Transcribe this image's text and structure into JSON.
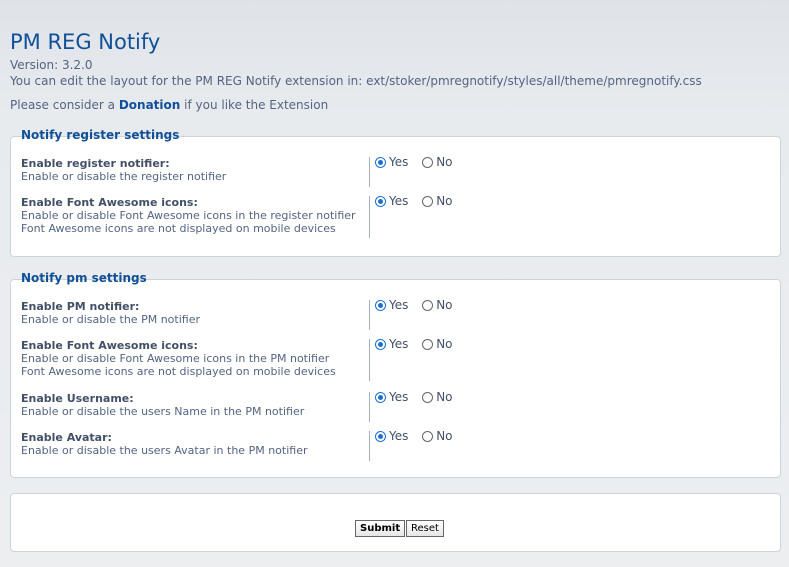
{
  "header": {
    "title": "PM REG Notify",
    "version": "Version: 3.2.0",
    "edit_info": "You can edit the layout for the PM REG Notify extension in: ext/stoker/pmregnotify/styles/all/theme/pmregnotify.css",
    "donation_prefix": "Please consider a",
    "donation_link": "Donation",
    "donation_suffix": "if you like the Extension"
  },
  "register_settings": {
    "legend": "Notify register settings",
    "rows": [
      {
        "title": "Enable register notifier:",
        "desc": "Enable or disable the register notifier",
        "desc2": "",
        "yes": "Yes",
        "no": "No",
        "selected": "yes"
      },
      {
        "title": "Enable Font Awesome icons:",
        "desc": "Enable or disable Font Awesome icons in the register notifier",
        "desc2": "Font Awesome icons are not displayed on mobile devices",
        "yes": "Yes",
        "no": "No",
        "selected": "yes"
      }
    ]
  },
  "pm_settings": {
    "legend": "Notify pm settings",
    "rows": [
      {
        "title": "Enable PM notifier:",
        "desc": "Enable or disable the PM notifier",
        "desc2": "",
        "yes": "Yes",
        "no": "No",
        "selected": "yes"
      },
      {
        "title": "Enable Font Awesome icons:",
        "desc": "Enable or disable Font Awesome icons in the PM notifier",
        "desc2": "Font Awesome icons are not displayed on mobile devices",
        "yes": "Yes",
        "no": "No",
        "selected": "yes"
      },
      {
        "title": "Enable Username:",
        "desc": "Enable or disable the users Name in the PM notifier",
        "desc2": "",
        "yes": "Yes",
        "no": "No",
        "selected": "yes"
      },
      {
        "title": "Enable Avatar:",
        "desc": "Enable or disable the users Avatar in the PM notifier",
        "desc2": "",
        "yes": "Yes",
        "no": "No",
        "selected": "yes"
      }
    ]
  },
  "actions": {
    "submit_label": "Submit",
    "reset_label": "Reset"
  }
}
